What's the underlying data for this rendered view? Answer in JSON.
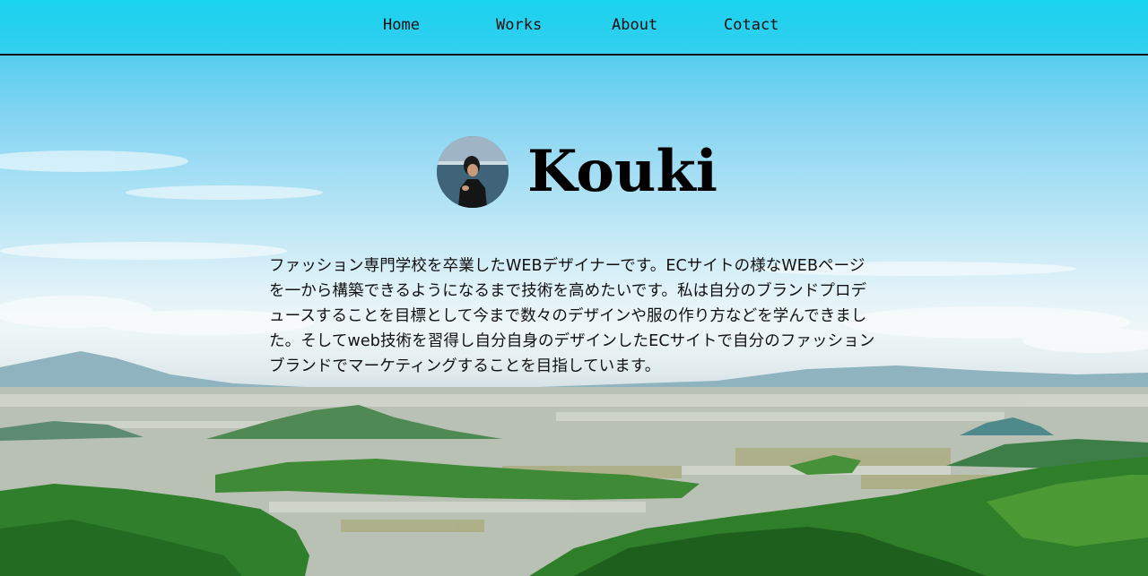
{
  "nav": {
    "items": [
      {
        "label": "Home"
      },
      {
        "label": "Works"
      },
      {
        "label": "About"
      },
      {
        "label": "Cotact"
      }
    ]
  },
  "hero": {
    "title": "Kouki",
    "avatar_icon": "profile-photo",
    "intro": "ファッション専門学校を卒業したWEBデザイナーです。ECサイトの様なWEBページを一から構築できるようになるまで技術を高めたいです。私は自分のブランドプロデュースすることを目標として今まで数々のデザインや服の作り方などを学んできました。そしてweb技術を習得し自分自身のデザインしたECサイトで自分のファッションブランドでマーケティングすることを目指しています。"
  },
  "colors": {
    "sky": "#19d2ee",
    "text": "#111111"
  }
}
